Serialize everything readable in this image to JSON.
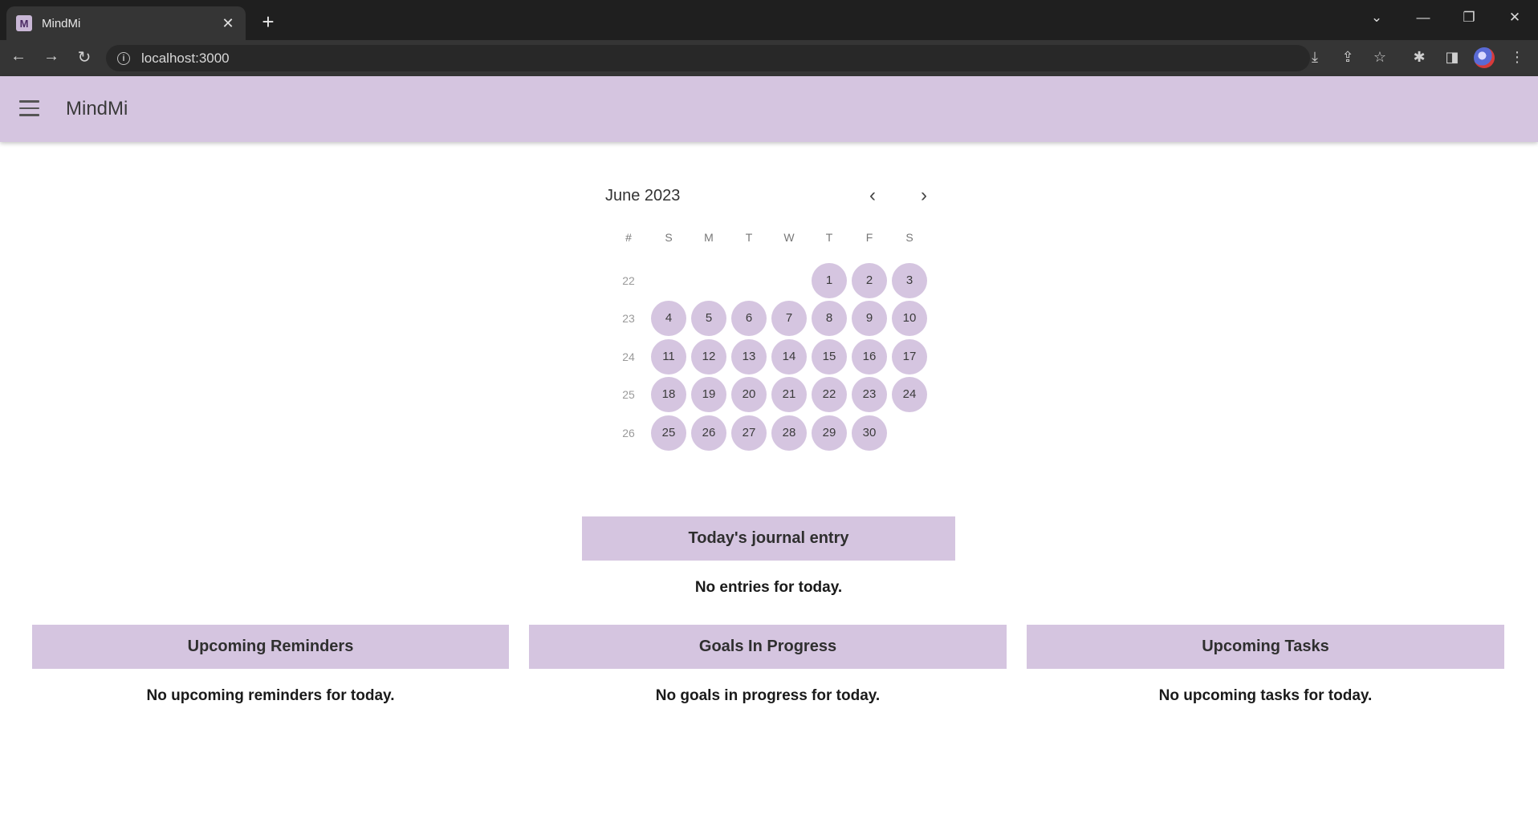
{
  "browser": {
    "tab_title": "MindMi",
    "favicon_letter": "M",
    "tab_close": "✕",
    "new_tab": "+",
    "url": "localhost:3000",
    "window_controls": {
      "dropdown": "⌄",
      "minimize": "—",
      "restore": "❐",
      "close": "✕"
    },
    "nav": {
      "back": "←",
      "forward": "→",
      "reload": "↻"
    },
    "toolbar_icons": {
      "install": "⤓",
      "share": "⇪",
      "bookmark": "☆",
      "extensions": "✱",
      "sidepanel": "◨",
      "menu": "⋮"
    }
  },
  "app": {
    "title": "MindMi",
    "accent_color": "#d5c5e0"
  },
  "calendar": {
    "month_label": "June 2023",
    "prev_icon": "‹",
    "next_icon": "›",
    "week_header": "#",
    "day_headers": [
      "S",
      "M",
      "T",
      "W",
      "T",
      "F",
      "S"
    ],
    "weeks": [
      {
        "number": "22",
        "days": [
          "",
          "",
          "",
          "",
          "1",
          "2",
          "3"
        ]
      },
      {
        "number": "23",
        "days": [
          "4",
          "5",
          "6",
          "7",
          "8",
          "9",
          "10"
        ]
      },
      {
        "number": "24",
        "days": [
          "11",
          "12",
          "13",
          "14",
          "15",
          "16",
          "17"
        ]
      },
      {
        "number": "25",
        "days": [
          "18",
          "19",
          "20",
          "21",
          "22",
          "23",
          "24"
        ]
      },
      {
        "number": "26",
        "days": [
          "25",
          "26",
          "27",
          "28",
          "29",
          "30",
          ""
        ]
      }
    ]
  },
  "journal": {
    "header": "Today's journal entry",
    "message": "No entries for today."
  },
  "reminders": {
    "header": "Upcoming Reminders",
    "message": "No upcoming reminders for today."
  },
  "goals": {
    "header": "Goals In Progress",
    "message": "No goals in progress for today."
  },
  "tasks": {
    "header": "Upcoming Tasks",
    "message": "No upcoming tasks for today."
  }
}
